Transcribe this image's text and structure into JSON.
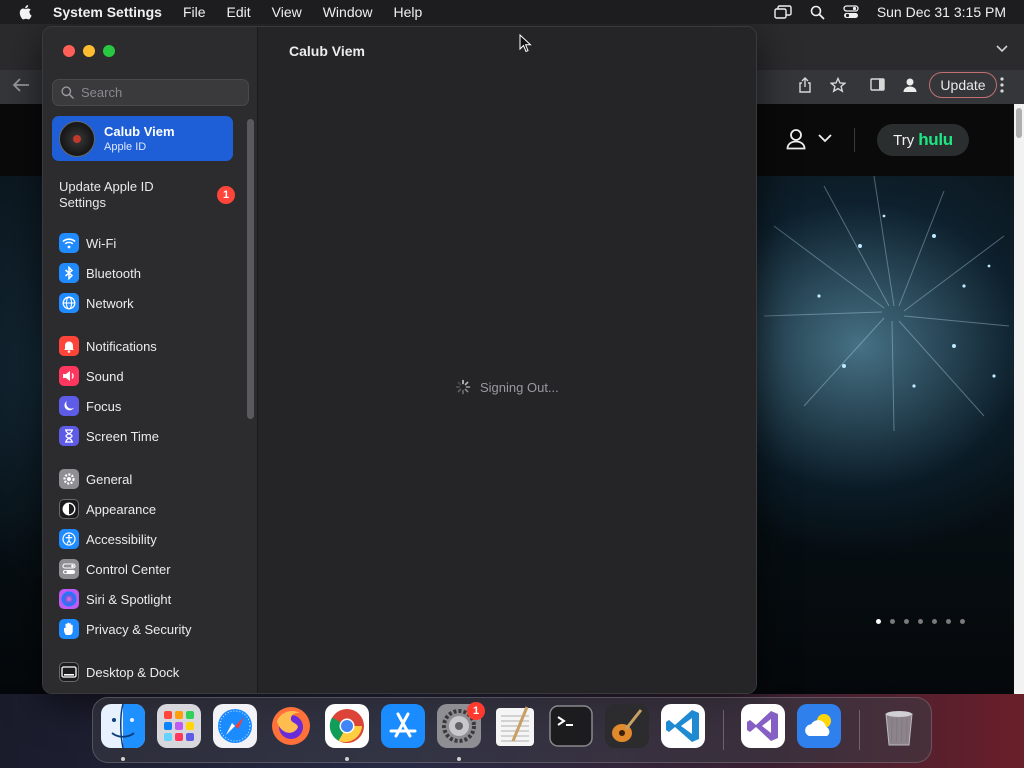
{
  "menubar": {
    "app_name": "System Settings",
    "menus": [
      "File",
      "Edit",
      "View",
      "Window",
      "Help"
    ],
    "clock": "Sun Dec 31  3:15 PM"
  },
  "browser": {
    "update_label": "Update",
    "try_label": "Try",
    "brand_label": "hulu",
    "carousel_dots": 7,
    "carousel_active": 1
  },
  "settings": {
    "search_placeholder": "Search",
    "account": {
      "name": "Calub Viem",
      "subtitle": "Apple ID"
    },
    "update_row": {
      "label": "Update Apple ID Settings",
      "badge": "1"
    },
    "groups": [
      [
        {
          "id": "wifi",
          "label": "Wi-Fi",
          "color": "#1f8bff",
          "icon": "wifi-icon"
        },
        {
          "id": "bluetooth",
          "label": "Bluetooth",
          "color": "#1f8bff",
          "icon": "bluetooth-icon"
        },
        {
          "id": "network",
          "label": "Network",
          "color": "#1f8bff",
          "icon": "globe-icon"
        }
      ],
      [
        {
          "id": "notifications",
          "label": "Notifications",
          "color": "#ff453a",
          "icon": "bell-icon"
        },
        {
          "id": "sound",
          "label": "Sound",
          "color": "#ff375f",
          "icon": "speaker-icon"
        },
        {
          "id": "focus",
          "label": "Focus",
          "color": "#5e5ce6",
          "icon": "moon-icon"
        },
        {
          "id": "screen-time",
          "label": "Screen Time",
          "color": "#5e5ce6",
          "icon": "hourglass-icon"
        }
      ],
      [
        {
          "id": "general",
          "label": "General",
          "color": "#8e8e93",
          "icon": "gear-icon"
        },
        {
          "id": "appearance",
          "label": "Appearance",
          "color": "#1c1c1e",
          "icon": "appearance-icon"
        },
        {
          "id": "accessibility",
          "label": "Accessibility",
          "color": "#1f8bff",
          "icon": "accessibility-icon"
        },
        {
          "id": "control-center",
          "label": "Control Center",
          "color": "#8e8e93",
          "icon": "toggles-icon"
        },
        {
          "id": "siri",
          "label": "Siri & Spotlight",
          "color": "#bf5af2",
          "icon": "siri-icon"
        },
        {
          "id": "privacy",
          "label": "Privacy & Security",
          "color": "#1f8bff",
          "icon": "hand-icon"
        }
      ],
      [
        {
          "id": "desktop-dock",
          "label": "Desktop & Dock",
          "color": "#1c1c1e",
          "icon": "dock-icon"
        }
      ]
    ],
    "content_title": "Calub Viem",
    "status_text": "Signing Out..."
  },
  "dock": {
    "apps": [
      {
        "id": "finder",
        "icon": "finder-icon",
        "color": "#1e90ff",
        "running": true
      },
      {
        "id": "launchpad",
        "icon": "launchpad-icon",
        "color": "#d8d8dc",
        "running": false
      },
      {
        "id": "safari",
        "icon": "safari-icon",
        "color": "#f2f2f7",
        "running": false
      },
      {
        "id": "firefox",
        "icon": "firefox-icon",
        "color": "#3b1d6e",
        "running": false
      },
      {
        "id": "chrome",
        "icon": "chrome-icon",
        "color": "#ffffff",
        "running": true
      },
      {
        "id": "app-store",
        "icon": "app-store-icon",
        "color": "#1a8cff",
        "running": false
      },
      {
        "id": "system-settings",
        "icon": "settings-gear-icon",
        "color": "#8e8e93",
        "running": true,
        "badge": "1"
      },
      {
        "id": "textedit",
        "icon": "textedit-icon",
        "color": "#f5f5f5",
        "running": false
      },
      {
        "id": "terminal",
        "icon": "terminal-icon",
        "color": "#1c1c1e",
        "running": false
      },
      {
        "id": "garageband",
        "icon": "guitar-icon",
        "color": "#2c2c2e",
        "running": false
      },
      {
        "id": "vscode",
        "icon": "vscode-icon",
        "color": "#ffffff",
        "running": false
      },
      {
        "id": "visual-studio",
        "icon": "visual-studio-icon",
        "color": "#ffffff",
        "running": false
      },
      {
        "id": "weather",
        "icon": "weather-icon",
        "color": "#2f80ed",
        "running": false
      },
      {
        "id": "trash",
        "icon": "trash-icon",
        "color": "transparent",
        "running": false
      }
    ]
  }
}
